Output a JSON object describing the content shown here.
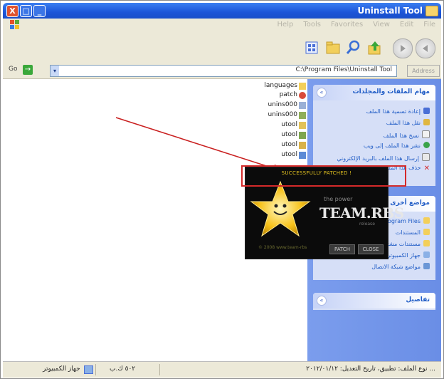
{
  "window": {
    "title": "Uninstall Tool",
    "close_label": "X",
    "max_label": "□",
    "min_label": "_"
  },
  "menu": [
    "File",
    "Edit",
    "View",
    "Favorites",
    "Tools",
    "Help"
  ],
  "address": {
    "go_label": "Go",
    "go_arrow": "→",
    "path": "C:\\Program Files\\Uninstall Tool",
    "dropdown_label": "▾",
    "right_label": "Address"
  },
  "files": [
    {
      "name": "languages",
      "color": "#f3cf5a"
    },
    {
      "name": "patch",
      "color": "#d94a3a"
    },
    {
      "name": "unins000",
      "color": "#9ab0d6"
    },
    {
      "name": "unins000",
      "color": "#8fae5a"
    },
    {
      "name": "utool",
      "color": "#e2c25a"
    },
    {
      "name": "utool",
      "color": "#7fa64f"
    },
    {
      "name": "utool",
      "color": "#d9b24a"
    },
    {
      "name": "utool",
      "color": "#5c8ad6"
    }
  ],
  "taskpane": {
    "file_tasks_title": "مهام الملفات والمجلدات",
    "file_tasks": [
      {
        "label": "إعادة تسمية هذا الملف",
        "color": "#4a6fd6"
      },
      {
        "label": "نقل هذا الملف",
        "color": "#e0b640"
      },
      {
        "label": "نسخ هذا الملف",
        "color": "#f2f2f2"
      },
      {
        "label": "نشر هذا الملف إلى ويب",
        "color": "#3aa34a"
      },
      {
        "label": "إرسال هذا الملف بالبريد الإلكتروني",
        "color": "#e9e9e9"
      },
      {
        "label": "حذف هذا الملف",
        "color": "#d62b2b"
      }
    ],
    "other_places_title": "مواضع أخرى",
    "other_places": [
      {
        "label": "Program Files",
        "color": "#f3cf5a"
      },
      {
        "label": "المستندات",
        "color": "#f3cf5a"
      },
      {
        "label": "مستندات مشتركة",
        "color": "#f3cf5a"
      },
      {
        "label": "جهاز الكمبيوتر",
        "color": "#8ab0e6"
      },
      {
        "label": "مواضع شبكة الاتصال",
        "color": "#6a96d6"
      }
    ],
    "details_title": "تفاصيل",
    "collapse_icon": "«"
  },
  "dialog": {
    "title": "SUCCESSFULLY PATCHED !",
    "brand_small": "the power",
    "brand": "TEAM.RBS",
    "brand_sub": "release",
    "footer": "© 2008 www.team-rbs",
    "btn_patch": "PATCH",
    "btn_close": "CLOSE"
  },
  "status": {
    "text": "نوع الملف: تطبيق، تاريخ التعديل: ٢٠١٢/٠١/١٢ ...",
    "size": "٥٠٢ ك.ب",
    "zone": "جهاز الكمبيوتر"
  }
}
